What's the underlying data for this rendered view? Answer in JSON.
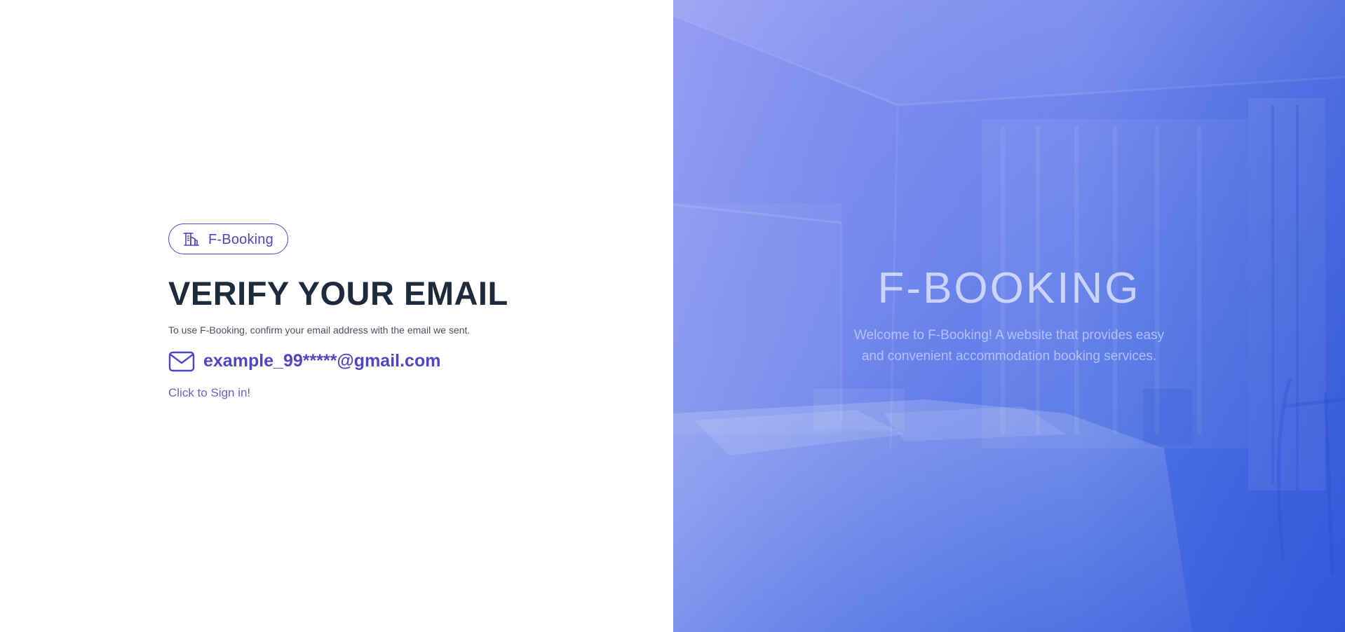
{
  "brand": {
    "name": "F-Booking",
    "icon": "building-icon"
  },
  "verify": {
    "title": "VERIFY YOUR EMAIL",
    "subtitle": "To use F-Booking, confirm your email address with the email we sent.",
    "email": "example_99*****@gmail.com",
    "email_icon": "mail-icon",
    "signin_link": "Click to Sign in!"
  },
  "hero": {
    "title": "F-BOOKING",
    "description": "Welcome to F-Booking! A website that provides easy and convenient accommodation booking services."
  },
  "colors": {
    "accent": "#4f46c4",
    "heading": "#1e2a3d",
    "hero_gradient_start": "#8b93f2",
    "hero_gradient_end": "#3a5fe0"
  }
}
